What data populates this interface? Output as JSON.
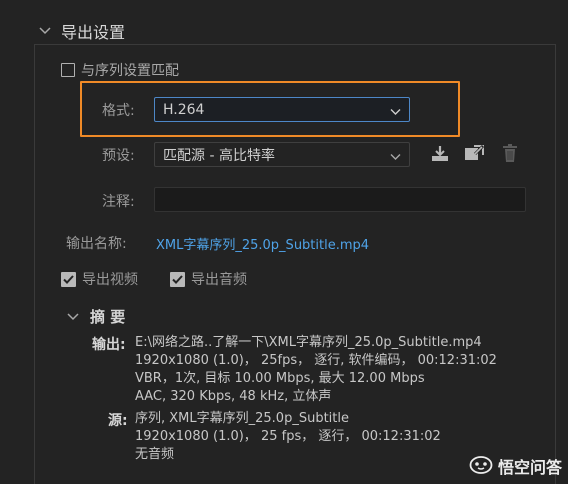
{
  "section": {
    "title": "导出设置"
  },
  "match_sequence": {
    "label": "与序列设置匹配",
    "checked": false
  },
  "format": {
    "label": "格式:",
    "value": "H.264"
  },
  "preset": {
    "label": "预设:",
    "value": "匹配源 - 高比特率"
  },
  "comment": {
    "label": "注释:",
    "value": ""
  },
  "output_name": {
    "label": "输出名称:",
    "value": "XML字幕序列_25.0p_Subtitle.mp4"
  },
  "export_video": {
    "label": "导出视频",
    "checked": true
  },
  "export_audio": {
    "label": "导出音频",
    "checked": true
  },
  "summary": {
    "title": "摘 要",
    "output_key": "输出:",
    "output_lines": [
      "E:\\网络之路..了解一下\\XML字幕序列_25.0p_Subtitle.mp4",
      "1920x1080 (1.0)， 25fps， 逐行, 软件编码， 00:12:31:02",
      "VBR，1次, 目标 10.00 Mbps, 最大 12.00 Mbps",
      "AAC, 320 Kbps, 48  kHz, 立体声"
    ],
    "source_key": "源:",
    "source_lines": [
      "序列, XML字幕序列_25.0p_Subtitle",
      "1920x1080 (1.0)， 25 fps， 逐行， 00:12:31:02",
      "无音频"
    ]
  },
  "watermark": {
    "text": "悟空问答"
  },
  "colors": {
    "highlight": "#f08a27",
    "link": "#4fa3e8",
    "accent_border": "#4d87c7"
  },
  "icons": {
    "section_toggle": "chevron-down-icon",
    "save_preset": "download-preset-icon",
    "import_preset": "import-preset-icon",
    "delete_preset": "trash-icon"
  }
}
